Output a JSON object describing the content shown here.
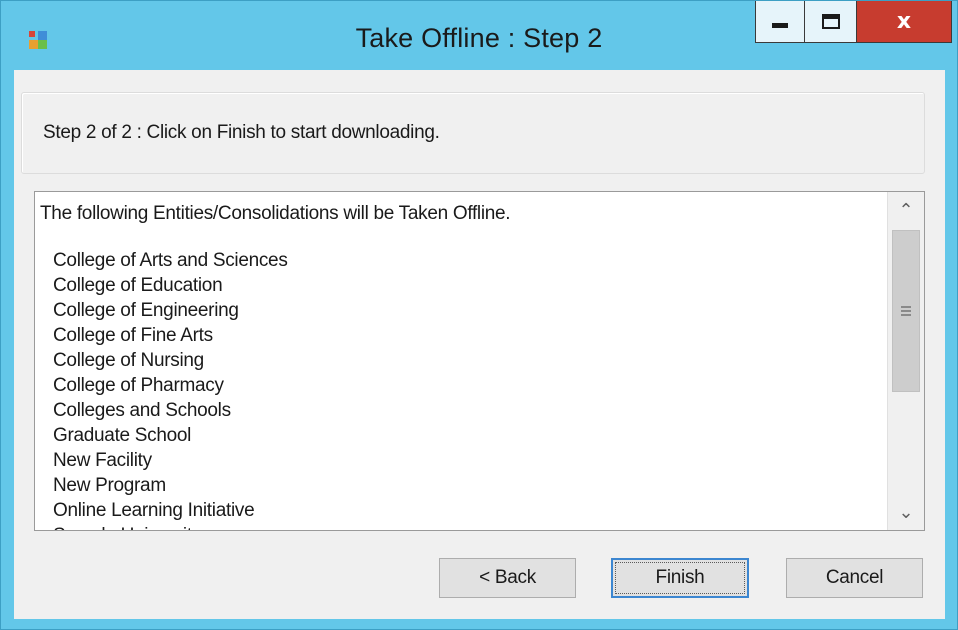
{
  "window": {
    "title": "Take Offline : Step 2",
    "close_label": "x"
  },
  "step": {
    "text": "Step 2 of 2 : Click on Finish to start downloading."
  },
  "list": {
    "header": "The following Entities/Consolidations will be Taken Offline.",
    "items": [
      "College of Arts and Sciences",
      "College of Education",
      "College of Engineering",
      "College of Fine Arts",
      "College of Nursing",
      "College of Pharmacy",
      "Colleges and Schools",
      "Graduate School",
      "New Facility",
      "New Program",
      "Online Learning Initiative",
      "Sample University"
    ]
  },
  "buttons": {
    "back": "< Back",
    "finish": "Finish",
    "cancel": "Cancel"
  },
  "colors": {
    "title_bar": "#63c7e9",
    "close_button": "#c73c2f",
    "client_bg": "#f0f0f0",
    "default_button_border": "#3c86d0"
  },
  "icons": {
    "app": "app-icon",
    "minimize": "minimize-icon",
    "maximize": "maximize-icon",
    "close": "close-icon",
    "scroll_up": "scroll-up-arrow-icon",
    "scroll_down": "scroll-down-arrow-icon"
  }
}
